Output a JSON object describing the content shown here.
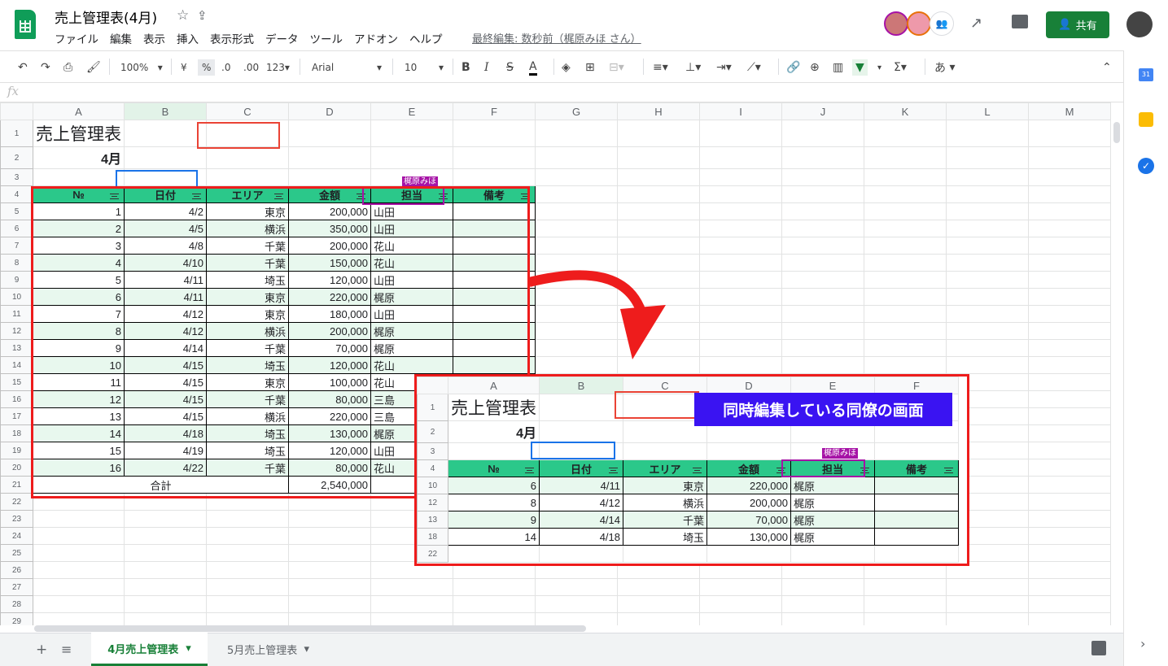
{
  "doc": {
    "title": "売上管理表(4月)",
    "last_edit": "最終編集: 数秒前（梶原みほ さん）",
    "share_label": "共有"
  },
  "menu": [
    "ファイル",
    "編集",
    "表示",
    "挿入",
    "表示形式",
    "データ",
    "ツール",
    "アドオン",
    "ヘルプ"
  ],
  "toolbar": {
    "zoom": "100%",
    "currency": "¥",
    "percent": "%",
    "dec_minus": ".0",
    "dec_plus": ".00",
    "format_more": "123",
    "font": "Arial",
    "font_size": "10",
    "bold": "B",
    "italic": "I",
    "strike": "S",
    "text_color": "A",
    "input_tool": "あ"
  },
  "formula": {
    "fx": "fx"
  },
  "columns": [
    "A",
    "B",
    "C",
    "D",
    "E",
    "F",
    "G",
    "H",
    "I",
    "J",
    "K",
    "L",
    "M"
  ],
  "sheet": {
    "title": "売上管理表",
    "month": "4月",
    "headers": [
      "№",
      "日付",
      "エリア",
      "金額",
      "担当",
      "備考"
    ],
    "rows": [
      [
        "1",
        "4/2",
        "東京",
        "200,000",
        "山田",
        ""
      ],
      [
        "2",
        "4/5",
        "横浜",
        "350,000",
        "山田",
        ""
      ],
      [
        "3",
        "4/8",
        "千葉",
        "200,000",
        "花山",
        ""
      ],
      [
        "4",
        "4/10",
        "千葉",
        "150,000",
        "花山",
        ""
      ],
      [
        "5",
        "4/11",
        "埼玉",
        "120,000",
        "山田",
        ""
      ],
      [
        "6",
        "4/11",
        "東京",
        "220,000",
        "梶原",
        ""
      ],
      [
        "7",
        "4/12",
        "東京",
        "180,000",
        "山田",
        ""
      ],
      [
        "8",
        "4/12",
        "横浜",
        "200,000",
        "梶原",
        ""
      ],
      [
        "9",
        "4/14",
        "千葉",
        "70,000",
        "梶原",
        ""
      ],
      [
        "10",
        "4/15",
        "埼玉",
        "120,000",
        "花山",
        ""
      ],
      [
        "11",
        "4/15",
        "東京",
        "100,000",
        "花山",
        ""
      ],
      [
        "12",
        "4/15",
        "千葉",
        "80,000",
        "三島",
        ""
      ],
      [
        "13",
        "4/15",
        "横浜",
        "220,000",
        "三島",
        ""
      ],
      [
        "14",
        "4/18",
        "埼玉",
        "130,000",
        "梶原",
        ""
      ],
      [
        "15",
        "4/19",
        "埼玉",
        "120,000",
        "山田",
        ""
      ],
      [
        "16",
        "4/22",
        "千葉",
        "80,000",
        "花山",
        ""
      ]
    ],
    "total_label": "合計",
    "total_value": "2,540,000",
    "collaborator": "梶原みほ"
  },
  "inset": {
    "label": "同時編集している同僚の画面",
    "columns": [
      "A",
      "B",
      "C",
      "D",
      "E",
      "F"
    ],
    "row_numbers": [
      "1",
      "2",
      "3",
      "4",
      "10",
      "12",
      "13",
      "18",
      "22"
    ],
    "rows": [
      [
        "6",
        "4/11",
        "東京",
        "220,000",
        "梶原",
        ""
      ],
      [
        "8",
        "4/12",
        "横浜",
        "200,000",
        "梶原",
        ""
      ],
      [
        "9",
        "4/14",
        "千葉",
        "70,000",
        "梶原",
        ""
      ],
      [
        "14",
        "4/18",
        "埼玉",
        "130,000",
        "梶原",
        ""
      ]
    ]
  },
  "tabs": [
    {
      "label": "4月売上管理表"
    },
    {
      "label": "5月売上管理表"
    }
  ]
}
